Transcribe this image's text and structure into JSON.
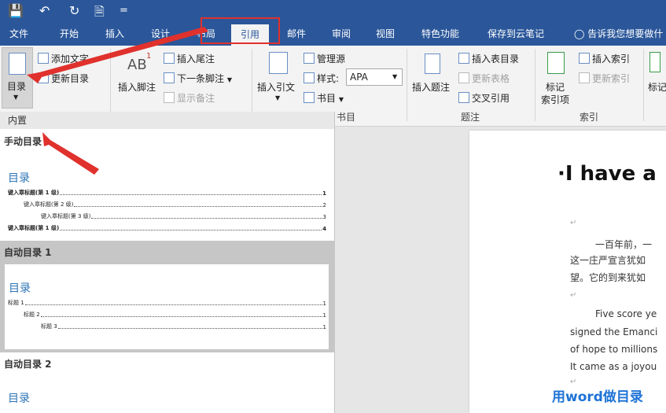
{
  "quick_access": {
    "dropdown": "="
  },
  "tabs": [
    {
      "label": "文件"
    },
    {
      "label": "开始"
    },
    {
      "label": "插入"
    },
    {
      "label": "设计"
    },
    {
      "label": "布局"
    },
    {
      "label": "引用"
    },
    {
      "label": "邮件"
    },
    {
      "label": "审阅"
    },
    {
      "label": "视图"
    },
    {
      "label": "特色功能"
    },
    {
      "label": "保存到云笔记"
    }
  ],
  "tell_me": "告诉我您想要做什",
  "ribbon": {
    "toc": {
      "big": "目录",
      "add_text": "添加文字",
      "update": "更新目录"
    },
    "footnotes": {
      "insert_footnote": "插入脚注",
      "insert_endnote": "插入尾注",
      "next_footnote": "下一条脚注",
      "show_notes": "显示备注",
      "ab_mark": "AB"
    },
    "citations": {
      "insert_citation": "插入引文",
      "manage_sources": "管理源",
      "style_label": "样式:",
      "style_value": "APA",
      "bibliography": "书目",
      "group": "书目"
    },
    "captions": {
      "insert_caption": "插入题注",
      "insert_table_figures": "插入表目录",
      "update_table": "更新表格",
      "cross_ref": "交叉引用",
      "group": "题注"
    },
    "index": {
      "mark_entry": "标记\n索引项",
      "mark_entry_1": "标记",
      "mark_entry_2": "索引项",
      "insert_index": "插入索引",
      "update_index": "更新索引",
      "group": "索引"
    },
    "extra": {
      "label": "标记"
    }
  },
  "panel": {
    "builtin": "内置",
    "manual": {
      "title": "手动目录",
      "heading": "目录",
      "entries": [
        {
          "text": "键入章标题(第 1 级)",
          "page": "1"
        },
        {
          "text": "键入章标题(第 2 级)",
          "page": "2"
        },
        {
          "text": "键入章标题(第 3 级)",
          "page": "3"
        },
        {
          "text": "键入章标题(第 1 级)",
          "page": "4"
        }
      ]
    },
    "auto1": {
      "title": "自动目录 1",
      "heading": "目录",
      "entries": [
        {
          "text": "标题 1",
          "page": "1"
        },
        {
          "text": "标题 2",
          "page": "1"
        },
        {
          "text": "标题 3",
          "page": "1"
        }
      ]
    },
    "auto2": {
      "title": "自动目录 2",
      "heading": "目录"
    }
  },
  "document": {
    "title": "·I have a",
    "cn_line1": "一百年前，一",
    "cn_line2": "这一庄严宣言犹如",
    "cn_line3": "望。它的到来犹如",
    "en_line1": "Five score ye",
    "en_line2": "signed the Emanci",
    "en_line3": "of hope to millions",
    "en_line4": "It came as a joyou",
    "para_mark": "↵"
  },
  "watermark": "用word做目录"
}
